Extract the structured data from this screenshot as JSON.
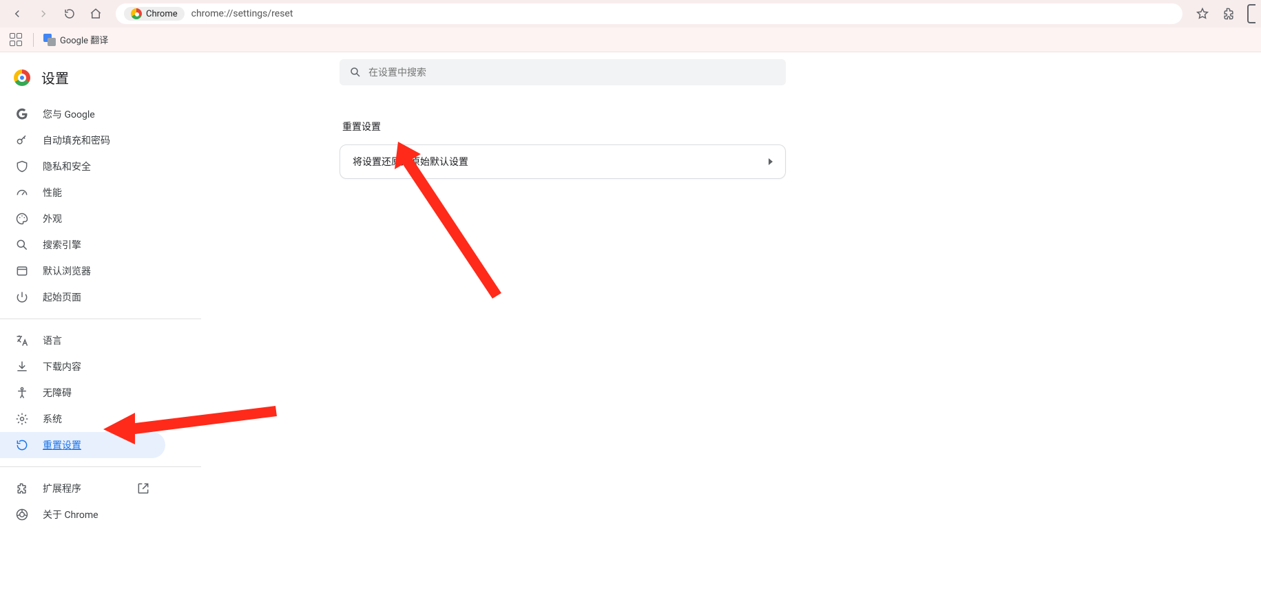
{
  "browser": {
    "site_chip_label": "Chrome",
    "url": "chrome://settings/reset"
  },
  "bookmarks": {
    "translate_label": "Google 翻译"
  },
  "sidebar": {
    "brand_title": "设置",
    "group1": [
      {
        "label": "您与 Google",
        "icon": "google",
        "name": "nav-you-and-google"
      },
      {
        "label": "自动填充和密码",
        "icon": "key",
        "name": "nav-autofill-passwords"
      },
      {
        "label": "隐私和安全",
        "icon": "shield",
        "name": "nav-privacy-security"
      },
      {
        "label": "性能",
        "icon": "speed",
        "name": "nav-performance"
      },
      {
        "label": "外观",
        "icon": "palette",
        "name": "nav-appearance"
      },
      {
        "label": "搜索引擎",
        "icon": "search",
        "name": "nav-search-engine"
      },
      {
        "label": "默认浏览器",
        "icon": "window",
        "name": "nav-default-browser"
      },
      {
        "label": "起始页面",
        "icon": "power",
        "name": "nav-on-startup"
      }
    ],
    "group2": [
      {
        "label": "语言",
        "icon": "translate",
        "name": "nav-languages"
      },
      {
        "label": "下载内容",
        "icon": "download",
        "name": "nav-downloads"
      },
      {
        "label": "无障碍",
        "icon": "accessibility",
        "name": "nav-accessibility"
      },
      {
        "label": "系统",
        "icon": "gear",
        "name": "nav-system"
      },
      {
        "label": "重置设置",
        "icon": "reset",
        "name": "nav-reset-settings",
        "selected": true
      }
    ],
    "group3": [
      {
        "label": "扩展程序",
        "icon": "extension",
        "name": "nav-extensions",
        "external": true
      },
      {
        "label": "关于 Chrome",
        "icon": "chrome",
        "name": "nav-about-chrome"
      }
    ]
  },
  "main": {
    "search_placeholder": "在设置中搜索",
    "section_title": "重置设置",
    "reset_row_label": "将设置还原为原始默认设置"
  }
}
